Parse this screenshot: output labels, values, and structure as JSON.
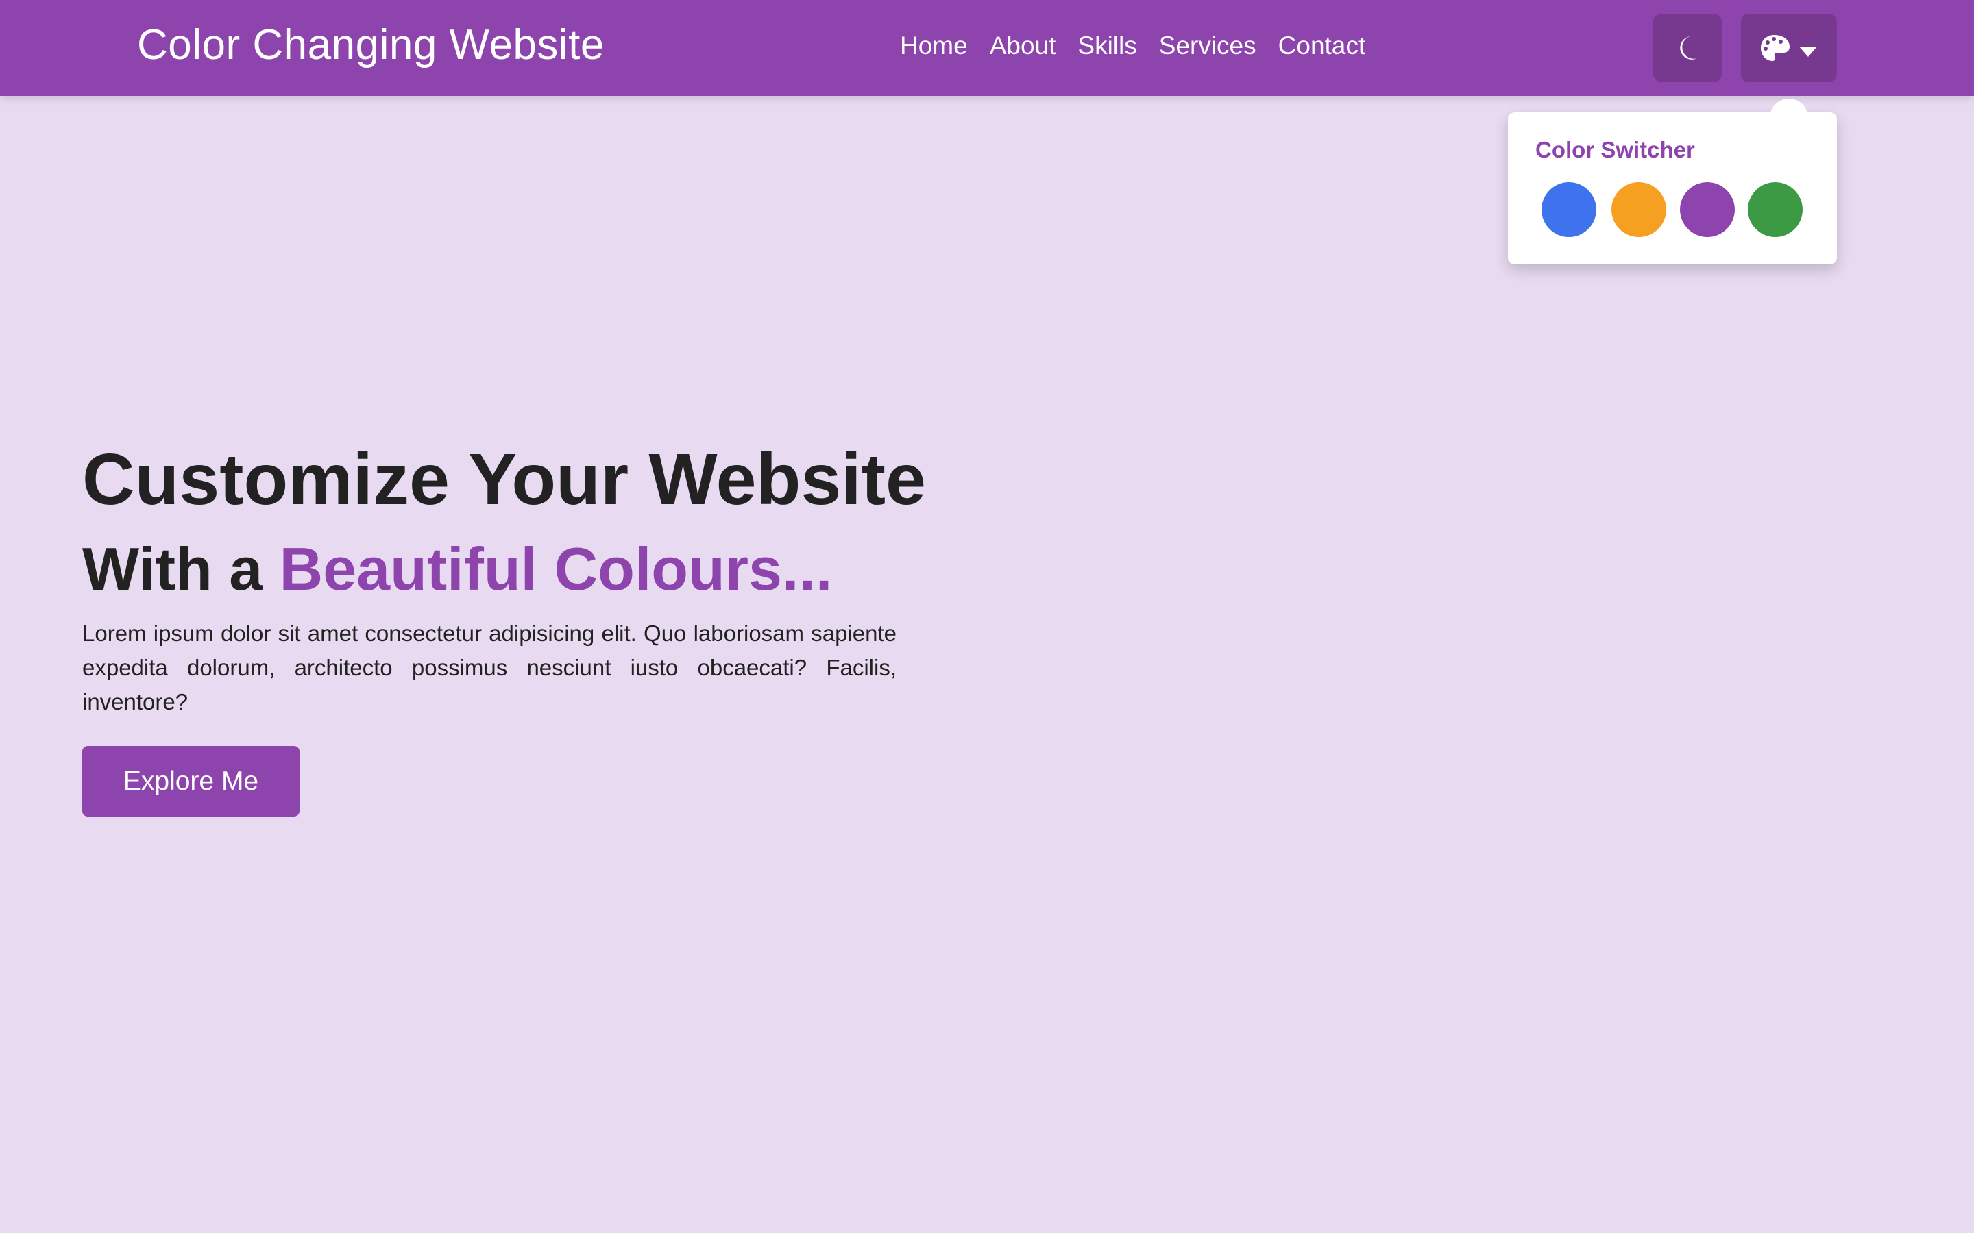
{
  "nav": {
    "title": "Color Changing Website",
    "links": [
      "Home",
      "About",
      "Skills",
      "Services",
      "Contact"
    ]
  },
  "icons": {
    "theme": "moon-icon",
    "palette": "palette-icon",
    "dropdown": "caret-down-icon"
  },
  "switcher": {
    "title": "Color Switcher",
    "colors": [
      "#3f73ed",
      "#f5a020",
      "#8e44ad",
      "#3b9a43"
    ]
  },
  "hero": {
    "heading": "Customize Your Website",
    "sub_prefix": "With a ",
    "sub_highlight": "Beautiful Colours...",
    "text": "Lorem ipsum dolor sit amet consectetur adipisicing elit. Quo laboriosam sapiente expedita dolorum, architecto possimus nesciunt iusto obcaecati? Facilis, inventore?",
    "button": "Explore Me"
  },
  "colors": {
    "accent": "#8e44ad",
    "background": "#e8daf0"
  }
}
